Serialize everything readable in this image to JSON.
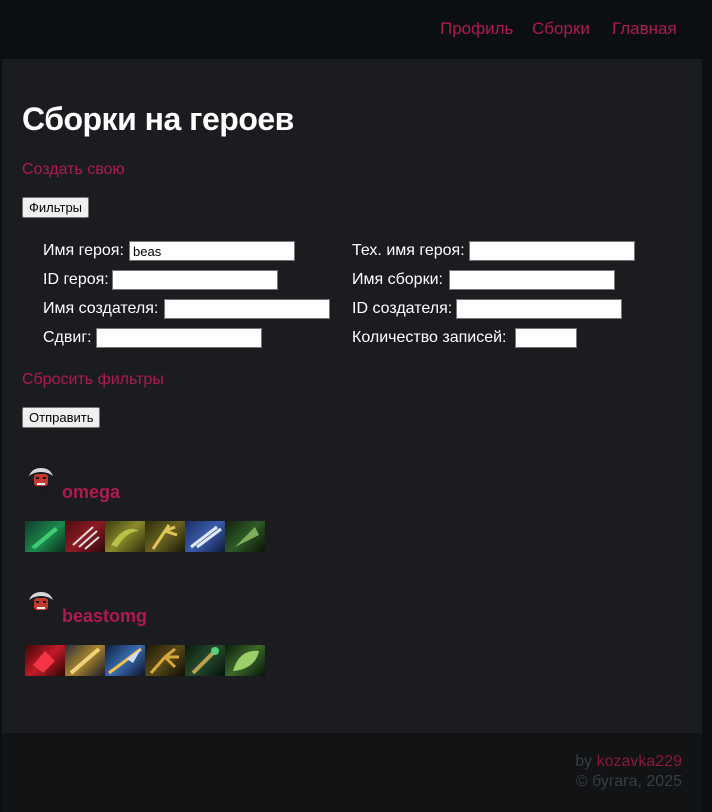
{
  "nav": {
    "profile": "Профиль",
    "builds": "Сборки",
    "home": "Главная"
  },
  "page": {
    "title": "Сборки на героев",
    "create_link": "Создать свою",
    "filters_button": "Фильтры",
    "reset_link": "Сбросить фильтры",
    "submit_button": "Отправить"
  },
  "filters": {
    "hero_name": {
      "label": "Имя героя:",
      "value": "beas"
    },
    "hero_tech_name": {
      "label": "Тех. имя героя:",
      "value": ""
    },
    "hero_id": {
      "label": "ID героя:",
      "value": ""
    },
    "build_name": {
      "label": "Имя сборки:",
      "value": ""
    },
    "creator_name": {
      "label": "Имя создателя:",
      "value": ""
    },
    "creator_id": {
      "label": "ID создателя:",
      "value": ""
    },
    "offset": {
      "label": "Сдвиг:",
      "value": ""
    },
    "limit": {
      "label": "Количество записей:",
      "value": ""
    }
  },
  "builds": [
    {
      "name": "omega",
      "hero_icon": "beastmaster-portrait-icon",
      "items": [
        "item-green-blade-icon",
        "item-red-claws-icon",
        "item-green-horn-icon",
        "item-golden-claw-icon",
        "item-blue-sword-icon",
        "item-green-axe-icon"
      ]
    },
    {
      "name": "beastomg",
      "hero_icon": "beastmaster-portrait-icon",
      "items": [
        "item-red-crystal-icon",
        "item-golden-staff-icon",
        "item-blue-lance-icon",
        "item-golden-claw-icon",
        "item-green-scepter-icon",
        "item-green-leaf-icon"
      ]
    }
  ],
  "footer": {
    "by_prefix": "by ",
    "author": "kozavka229",
    "copyright": "© бугага, 2025"
  },
  "colors": {
    "accent": "#b01a4d",
    "background": "#1b1c20",
    "header": "#0b0f12"
  }
}
